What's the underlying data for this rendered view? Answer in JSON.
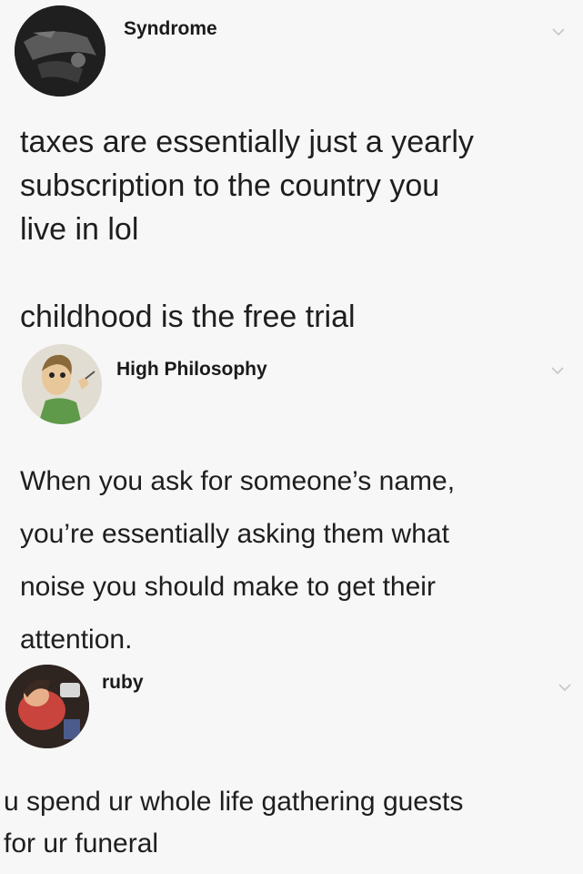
{
  "posts": [
    {
      "username": "Syndrome",
      "text": "taxes are essentially just a yearly\nsubscription to the country you\nlive in lol\n\nchildhood is the free trial"
    },
    {
      "username": "High Philosophy",
      "text": "When you ask for someone’s name,\nyou’re essentially asking them what\nnoise you should make to get their\nattention."
    },
    {
      "username": "ruby",
      "text": "u spend ur whole life gathering guests\nfor ur funeral"
    }
  ],
  "icons": {
    "chevron": "chevron-down-icon",
    "avatar": "avatar"
  },
  "colors": {
    "background": "#f7f7f7",
    "text": "#1e1e1e",
    "chevron": "#c8c8c8"
  }
}
